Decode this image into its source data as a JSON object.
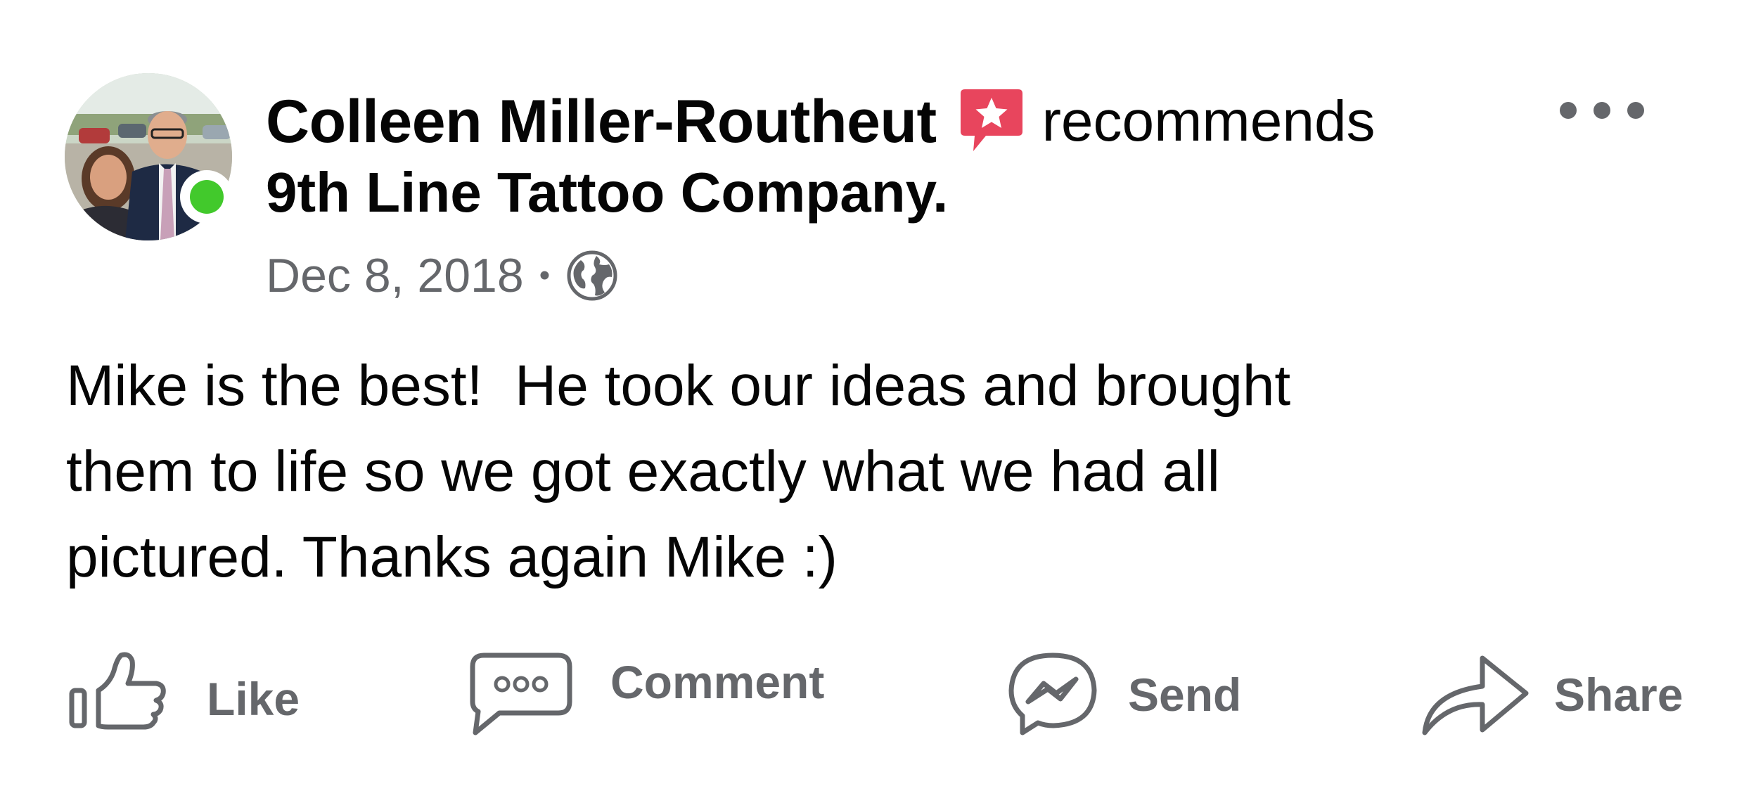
{
  "post": {
    "author": "Colleen Miller-Routheut",
    "action_text": "recommends",
    "page_name": "9th Line Tattoo Company.",
    "date": "Dec 8, 2018",
    "separator": "•",
    "privacy_icon": "globe-icon",
    "author_online": true,
    "body_lines": [
      "Mike is the best!  He took our ideas and brought",
      "them to life so we got exactly what we had all",
      "pictured. Thanks again Mike :)"
    ]
  },
  "actions": {
    "like": "Like",
    "comment": "Comment",
    "send": "Send",
    "share": "Share"
  },
  "colors": {
    "recommend_badge": "#e8455d",
    "online": "#42c92c",
    "secondary_text": "#65676b",
    "primary_text": "#050505"
  }
}
